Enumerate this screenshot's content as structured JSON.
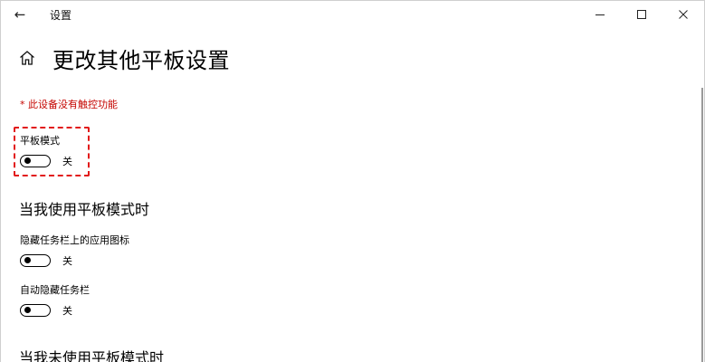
{
  "titlebar": {
    "title": "设置",
    "back_icon": "←",
    "minimize_icon": "minimize-icon",
    "maximize_icon": "maximize-icon",
    "close_icon": "close-icon"
  },
  "header": {
    "home_icon": "home-icon",
    "title": "更改其他平板设置"
  },
  "note": "* 此设备没有触控功能",
  "tablet_mode": {
    "label": "平板模式",
    "state": "关",
    "on": false
  },
  "when_tablet_mode": {
    "heading": "当我使用平板模式时",
    "settings": [
      {
        "label": "隐藏任务栏上的应用图标",
        "state": "关",
        "on": false
      },
      {
        "label": "自动隐藏任务栏",
        "state": "关",
        "on": false
      }
    ]
  },
  "when_not_tablet_mode": {
    "heading": "当我未使用平板模式时"
  },
  "colors": {
    "note": "#c50500",
    "highlight": "#e21a1a"
  }
}
